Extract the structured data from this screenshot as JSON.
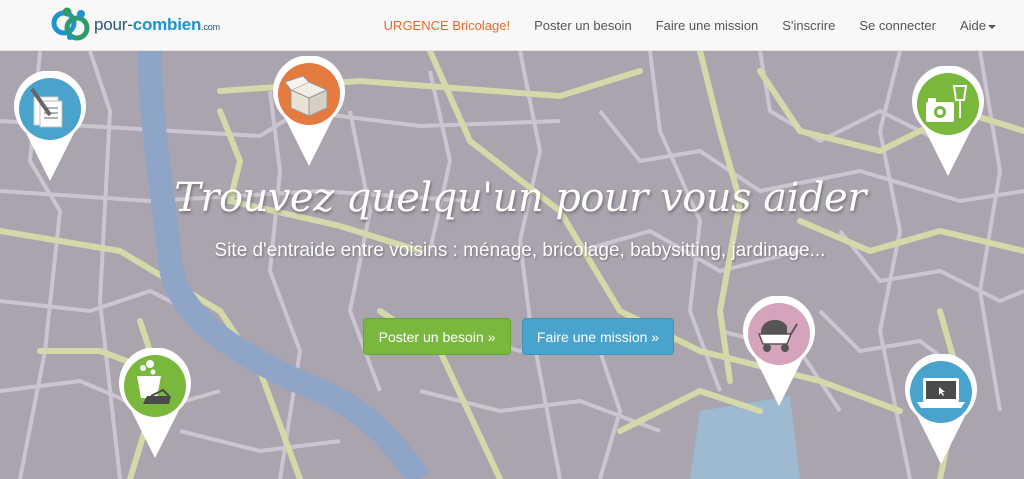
{
  "brand": {
    "name_part1": "pour-",
    "name_part2": "combien",
    "name_part3": ".com"
  },
  "nav": {
    "items": [
      {
        "label": "URGENCE Bricolage!"
      },
      {
        "label": "Poster un besoin"
      },
      {
        "label": "Faire une mission"
      },
      {
        "label": "S'inscrire"
      },
      {
        "label": "Se connecter"
      },
      {
        "label": "Aide"
      }
    ]
  },
  "hero": {
    "title": "Trouvez quelqu'un pour vous aider",
    "subtitle": "Site d'entraide entre voisins : ménage, bricolage, babysitting, jardinage...",
    "primary_button": "Poster un besoin »",
    "secondary_button": "Faire une mission »"
  },
  "colors": {
    "urgent": "#e0692d",
    "green": "#79b73d",
    "blue": "#4aa3cc",
    "orange": "#e47a3e",
    "pink": "#d6a3bc",
    "map_background": "#aaa4ae",
    "road": "#cfc6d3",
    "main_road": "#d6dba6",
    "river": "#8fa6c6"
  },
  "pins": [
    {
      "name": "documents",
      "icon": "document-pen-icon",
      "color": "#4aa3cc"
    },
    {
      "name": "moving",
      "icon": "cardboard-box-icon",
      "color": "#e47a3e"
    },
    {
      "name": "events",
      "icon": "camera-glasses-icon",
      "color": "#79b73d"
    },
    {
      "name": "cleaning",
      "icon": "bucket-iron-icon",
      "color": "#79b73d"
    },
    {
      "name": "babysitting",
      "icon": "stroller-icon",
      "color": "#d6a3bc"
    },
    {
      "name": "computer",
      "icon": "laptop-icon",
      "color": "#4aa3cc"
    }
  ]
}
